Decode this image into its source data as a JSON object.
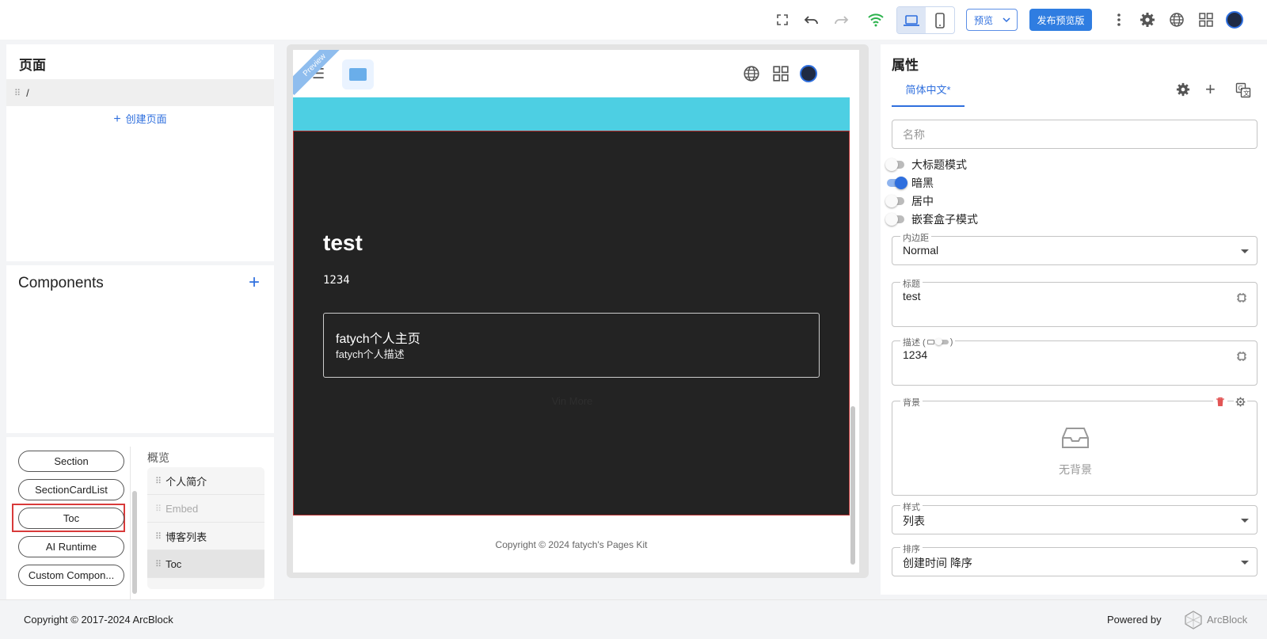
{
  "toolbar": {
    "preview_select": "预览",
    "publish_button": "发布预览版",
    "icons": [
      "fullscreen-icon",
      "undo-icon",
      "redo-icon",
      "wifi-icon",
      "laptop-icon",
      "phone-icon",
      "more-vert-icon",
      "gear-icon",
      "globe-icon",
      "apps-grid-icon",
      "avatar"
    ],
    "wifi_color": "#2bb24c",
    "accent": "#2f6fde"
  },
  "pages_panel": {
    "title": "页面",
    "items": [
      {
        "path": "/"
      }
    ],
    "create_label": "创建页面"
  },
  "components_panel": {
    "title": "Components"
  },
  "library": {
    "chips": [
      "Section",
      "SectionCardList",
      "Toc",
      "AI Runtime",
      "Custom Compon..."
    ],
    "selected_chip": "Toc",
    "overview_title": "概览",
    "overview_items": [
      {
        "label": "个人简介",
        "state": "normal"
      },
      {
        "label": "Embed",
        "state": "disabled"
      },
      {
        "label": "博客列表",
        "state": "normal"
      },
      {
        "label": "Toc",
        "state": "selected"
      }
    ]
  },
  "canvas": {
    "ribbon_label": "Preview",
    "section_title": "test",
    "section_desc": "1234",
    "card_title": "fatych个人主页",
    "card_desc": "fatych个人描述",
    "more_text": "Vin More",
    "footer": "Copyright © 2024 fatych's Pages Kit",
    "cyan": "#4dcfe3",
    "dark_bg": "#232323"
  },
  "properties": {
    "title": "属性",
    "tab_label": "简体中文*",
    "name_placeholder": "名称",
    "switches": [
      {
        "label": "大标题模式",
        "on": false
      },
      {
        "label": "暗黑",
        "on": true
      },
      {
        "label": "居中",
        "on": false
      },
      {
        "label": "嵌套盒子模式",
        "on": false
      }
    ],
    "padding": {
      "label": "内边距",
      "value": "Normal"
    },
    "title_field": {
      "label": "标题",
      "value": "test"
    },
    "desc_field": {
      "label": "描述 (",
      "label_end": ")",
      "value": "1234"
    },
    "background": {
      "label": "背景",
      "empty_text": "无背景"
    },
    "style": {
      "label": "样式",
      "value": "列表"
    },
    "sort": {
      "label": "排序",
      "value": "创建时间 降序"
    }
  },
  "footer": {
    "copyright": "Copyright © 2017-2024  ArcBlock",
    "powered_by": "Powered by",
    "brand": "ArcBlock"
  }
}
